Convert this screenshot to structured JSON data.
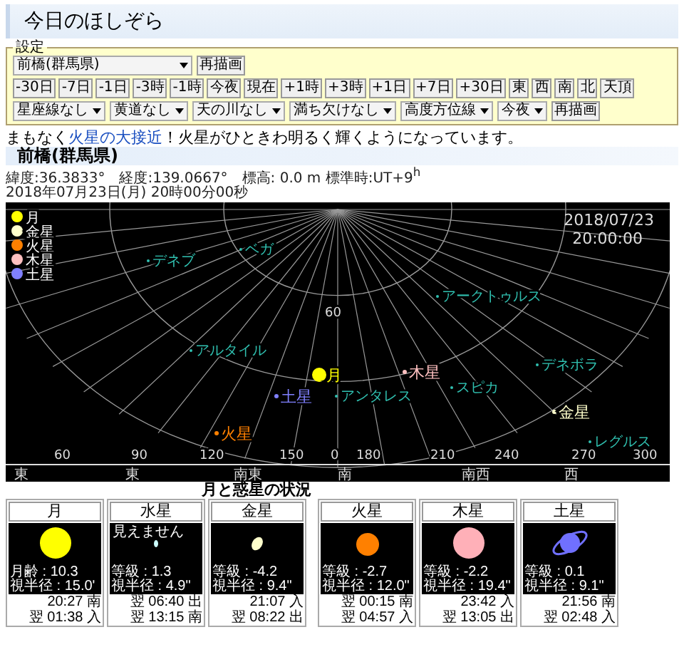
{
  "title": "今日のほしぞら",
  "settings": {
    "legend": "設定",
    "location": "前橋(群馬県)",
    "redraw": "再描画",
    "steps": [
      "-30日",
      "-7日",
      "-1日",
      "-3時",
      "-1時",
      "今夜",
      "現在",
      "+1時",
      "+3時",
      "+1日",
      "+7日",
      "+30日",
      "東",
      "西",
      "南",
      "北",
      "天頂"
    ],
    "options": [
      "星座線なし",
      "黄道なし",
      "天の川なし",
      "満ち欠けなし",
      "高度方位線",
      "今夜"
    ],
    "redraw_2": "再描画"
  },
  "notice": {
    "before": "まもなく",
    "link": "火星の大接近",
    "after": "！火星がひときわ明るく輝くようになっています。"
  },
  "place": "前橋(群馬県)",
  "coords": "緯度:36.3833°　経度:139.0667°　標高: 0.0 m 標準時:UT+9$^{h}$",
  "datetime": "2018年07月23日(月) 20時00分00秒",
  "sky": {
    "date": "2018/07/23",
    "time": "20:00:00",
    "legend": [
      {
        "label": "月",
        "color": "#ffff00"
      },
      {
        "label": "金星",
        "color": "#ffffcc"
      },
      {
        "label": "火星",
        "color": "#ff8000"
      },
      {
        "label": "木星",
        "color": "#ffc0c0"
      },
      {
        "label": "土星",
        "color": "#8080ff"
      }
    ],
    "altitude_label": "60",
    "stars": [
      "デネブ",
      "ベガ",
      "アークトゥルス",
      "アルタイル",
      "アンタレス",
      "スピカ",
      "デネボラ",
      "レグルス"
    ],
    "planets": [
      {
        "label": "月",
        "color": "#ffff00"
      },
      {
        "label": "木星",
        "color": "#ffc0c0"
      },
      {
        "label": "土星",
        "color": "#8080ff"
      },
      {
        "label": "金星",
        "color": "#ffffcc"
      },
      {
        "label": "火星",
        "color": "#ff8000"
      }
    ],
    "azimuths": [
      "60",
      "90",
      "120",
      "150",
      "0",
      "180",
      "210",
      "240",
      "270",
      "300"
    ],
    "directions": [
      "東",
      "東",
      "南東",
      "南",
      "南西",
      "西"
    ]
  },
  "status_title": "月と惑星の状況",
  "cards": [
    {
      "name": "月",
      "kind": "large",
      "color": "#ffff00",
      "stats": [
        "月齢 : 10.3",
        "視半径 : 15.0'"
      ],
      "events": [
        "20:27 南",
        "翌 01:38 入"
      ]
    },
    {
      "name": "水星",
      "kind": "tiny",
      "color": "#ccffff",
      "note": "見えません",
      "stats": [
        "等級 : 1.3",
        "視半径 : 4.9\""
      ],
      "events": [
        "翌 06:40 出",
        "翌 13:15 南"
      ]
    },
    {
      "name": "金星",
      "kind": "small",
      "color": "#ffffcc",
      "stats": [
        "等級 : -4.2",
        "視半径 : 9.4\""
      ],
      "events": [
        "21:07 入",
        "翌 08:22 出"
      ]
    },
    {
      "name": "火星",
      "kind": "medium",
      "color": "#ff8000",
      "group_start": true,
      "stats": [
        "等級 : -2.7",
        "視半径 : 12.0\""
      ],
      "events": [
        "翌 00:15 南",
        "翌 04:57 入"
      ]
    },
    {
      "name": "木星",
      "kind": "large",
      "color": "#ffb0b8",
      "stats": [
        "等級 : -2.2",
        "視半径 : 19.4\""
      ],
      "events": [
        "23:42 入",
        "翌 13:05 出"
      ]
    },
    {
      "name": "土星",
      "kind": "ringed",
      "color": "#7070ff",
      "stats": [
        "等級 : 0.1",
        "視半径 : 9.1\""
      ],
      "events": [
        "21:56 南",
        "翌 02:48 入"
      ]
    }
  ]
}
